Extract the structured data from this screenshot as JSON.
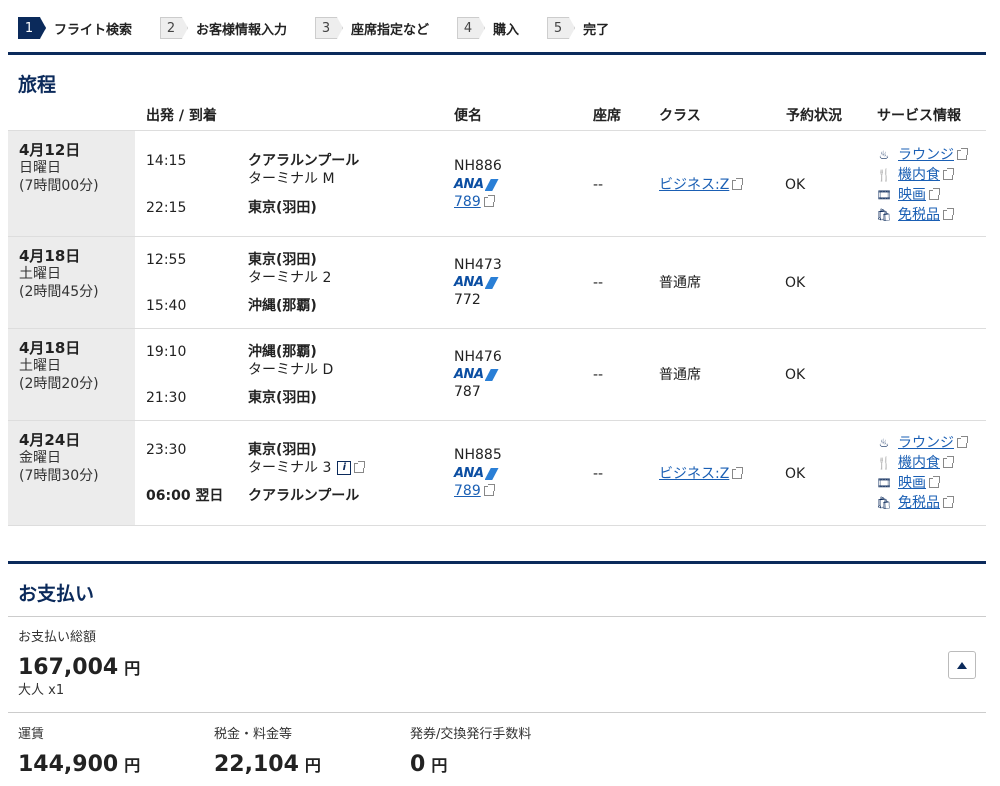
{
  "steps": [
    {
      "num": "1",
      "label": "フライト検索",
      "active": true
    },
    {
      "num": "2",
      "label": "お客様情報入力"
    },
    {
      "num": "3",
      "label": "座席指定など"
    },
    {
      "num": "4",
      "label": "購入"
    },
    {
      "num": "5",
      "label": "完了"
    }
  ],
  "itinerary": {
    "title": "旅程",
    "headers": {
      "depart_arrive": "出発 / 到着",
      "flight": "便名",
      "seat": "座席",
      "class": "クラス",
      "status": "予約状況",
      "service": "サービス情報"
    },
    "rows": [
      {
        "date": "4月12日",
        "dow": "日曜日",
        "duration": "(7時間00分)",
        "dep_time": "14:15",
        "dep_place": "クアラルンプール",
        "terminal": "ターミナル M",
        "arr_time": "22:15",
        "arr_place": "東京(羽田)",
        "flight_no": "NH886",
        "airline": "ANA",
        "aircraft": "789",
        "seat": "--",
        "class": "ビジネス:Z",
        "status": "OK",
        "services": [
          "ラウンジ",
          "機内食",
          "映画",
          "免税品"
        ]
      },
      {
        "date": "4月18日",
        "dow": "土曜日",
        "duration": "(2時間45分)",
        "dep_time": "12:55",
        "dep_place": "東京(羽田)",
        "terminal": "ターミナル 2",
        "arr_time": "15:40",
        "arr_place": "沖縄(那覇)",
        "flight_no": "NH473",
        "airline": "ANA",
        "aircraft": "772",
        "seat": "--",
        "class": "普通席",
        "status": "OK"
      },
      {
        "date": "4月18日",
        "dow": "土曜日",
        "duration": "(2時間20分)",
        "dep_time": "19:10",
        "dep_place": "沖縄(那覇)",
        "terminal": "ターミナル D",
        "arr_time": "21:30",
        "arr_place": "東京(羽田)",
        "flight_no": "NH476",
        "airline": "ANA",
        "aircraft": "787",
        "seat": "--",
        "class": "普通席",
        "status": "OK"
      },
      {
        "date": "4月24日",
        "dow": "金曜日",
        "duration": "(7時間30分)",
        "dep_time": "23:30",
        "dep_place": "東京(羽田)",
        "terminal": "ターミナル 3",
        "arr_time": "06:00 翌日",
        "arr_place": "クアラルンプール",
        "flight_no": "NH885",
        "airline": "ANA",
        "aircraft": "789",
        "seat": "--",
        "class": "ビジネス:Z",
        "status": "OK",
        "services": [
          "ラウンジ",
          "機内食",
          "映画",
          "免税品"
        ]
      }
    ]
  },
  "payment": {
    "title": "お支払い",
    "total_label": "お支払い総額",
    "total": "167,004",
    "yen": "円",
    "pax": "大人 x1",
    "fare_label": "運賃",
    "fare": "144,900",
    "tax_label": "税金・料金等",
    "tax": "22,104",
    "fee_label": "発券/交換発行手数料",
    "fee": "0"
  },
  "colors": {
    "brand": "#0b2a5b",
    "link": "#1a5fb4"
  }
}
